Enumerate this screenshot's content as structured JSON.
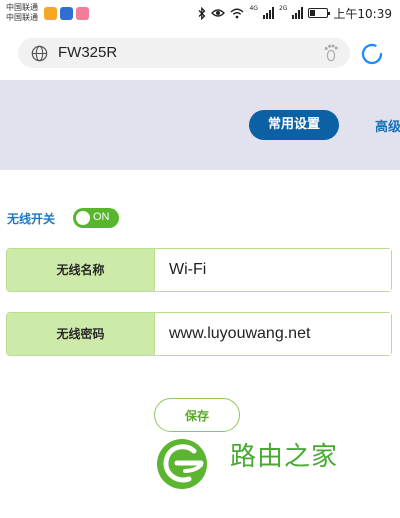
{
  "status_bar": {
    "carrier_lines": [
      "中国联通",
      "中国联通"
    ],
    "app_icons": [
      {
        "name": "weibo-icon",
        "color": "#f5a623"
      },
      {
        "name": "news-app-icon",
        "color": "#2f6fd1"
      },
      {
        "name": "photo-app-icon",
        "color": "#f27c9a"
      }
    ],
    "network_tags": [
      "4G",
      "2G"
    ],
    "clock": "上午10:39"
  },
  "address_bar": {
    "url": "FW325R"
  },
  "tabs": {
    "common": "常用设置",
    "advanced": "高级"
  },
  "wireless": {
    "switch_label": "无线开关",
    "switch_state": "ON",
    "name_label": "无线名称",
    "name_value": "Wi-Fi",
    "password_label": "无线密码",
    "password_value": "www.luyouwang.net"
  },
  "actions": {
    "save": "保存"
  },
  "watermark": {
    "text": "路由之家"
  },
  "colors": {
    "accent_blue": "#0c60a4",
    "header_band": "#e2e2ef",
    "label_green": "#cdeaa9",
    "toggle_green": "#57b62b",
    "watermark_green": "#49a932"
  }
}
